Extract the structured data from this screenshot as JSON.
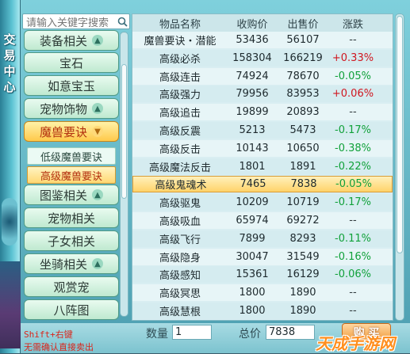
{
  "window": {
    "side_title": "交易中心"
  },
  "search": {
    "placeholder": "请输入关键字搜索"
  },
  "categories": [
    {
      "label": "装备相关",
      "expandable": true,
      "expanded": false
    },
    {
      "label": "宝石",
      "expandable": false
    },
    {
      "label": "如意宝玉",
      "expandable": false
    },
    {
      "label": "宠物饰物",
      "expandable": true,
      "expanded": false
    },
    {
      "label": "魔兽要诀",
      "expandable": true,
      "expanded": true,
      "active": true
    },
    {
      "label": "图鉴相关",
      "expandable": true,
      "expanded": false
    },
    {
      "label": "宠物相关",
      "expandable": false
    },
    {
      "label": "子女相关",
      "expandable": false
    },
    {
      "label": "坐骑相关",
      "expandable": true,
      "expanded": false
    },
    {
      "label": "观赏宠",
      "expandable": false
    },
    {
      "label": "八阵图",
      "expandable": false
    }
  ],
  "subcategories": [
    {
      "label": "低级魔兽要诀",
      "selected": false
    },
    {
      "label": "高级魔兽要诀",
      "selected": true
    }
  ],
  "table": {
    "headers": {
      "name": "物品名称",
      "buy": "收购价",
      "sell": "出售价",
      "change": "涨跌"
    },
    "rows": [
      {
        "name": "魔兽要诀・潜能",
        "buy": "53436",
        "sell": "56107",
        "change": "--",
        "trend": "flat"
      },
      {
        "name": "高级必杀",
        "buy": "158304",
        "sell": "166219",
        "change": "+0.33%",
        "trend": "up"
      },
      {
        "name": "高级连击",
        "buy": "74924",
        "sell": "78670",
        "change": "-0.05%",
        "trend": "down"
      },
      {
        "name": "高级强力",
        "buy": "79956",
        "sell": "83953",
        "change": "+0.06%",
        "trend": "up"
      },
      {
        "name": "高级追击",
        "buy": "19899",
        "sell": "20893",
        "change": "--",
        "trend": "flat"
      },
      {
        "name": "高级反震",
        "buy": "5213",
        "sell": "5473",
        "change": "-0.17%",
        "trend": "down"
      },
      {
        "name": "高级反击",
        "buy": "10143",
        "sell": "10650",
        "change": "-0.38%",
        "trend": "down"
      },
      {
        "name": "高级魔法反击",
        "buy": "1801",
        "sell": "1891",
        "change": "-0.22%",
        "trend": "down"
      },
      {
        "name": "高级鬼魂术",
        "buy": "7465",
        "sell": "7838",
        "change": "-0.05%",
        "trend": "down",
        "selected": true
      },
      {
        "name": "高级驱鬼",
        "buy": "10209",
        "sell": "10719",
        "change": "-0.17%",
        "trend": "down"
      },
      {
        "name": "高级吸血",
        "buy": "65974",
        "sell": "69272",
        "change": "--",
        "trend": "flat"
      },
      {
        "name": "高级飞行",
        "buy": "7899",
        "sell": "8293",
        "change": "-0.11%",
        "trend": "down"
      },
      {
        "name": "高级隐身",
        "buy": "30047",
        "sell": "31549",
        "change": "-0.16%",
        "trend": "down"
      },
      {
        "name": "高级感知",
        "buy": "15361",
        "sell": "16129",
        "change": "-0.06%",
        "trend": "down"
      },
      {
        "name": "高级冥思",
        "buy": "1800",
        "sell": "1890",
        "change": "--",
        "trend": "flat"
      },
      {
        "name": "高级慧根",
        "buy": "1800",
        "sell": "1890",
        "change": "--",
        "trend": "flat"
      }
    ]
  },
  "bottom": {
    "hint_line1": "Shift+右键",
    "hint_line2": "无需确认直接卖出",
    "quantity_label": "数量",
    "quantity_value": "1",
    "total_label": "总价",
    "total_value": "7838",
    "buy_button": "购 买",
    "watermark": "天成手游网"
  },
  "colors": {
    "up": "#d0161f",
    "down": "#11a13a",
    "accent": "#ffd36a"
  }
}
